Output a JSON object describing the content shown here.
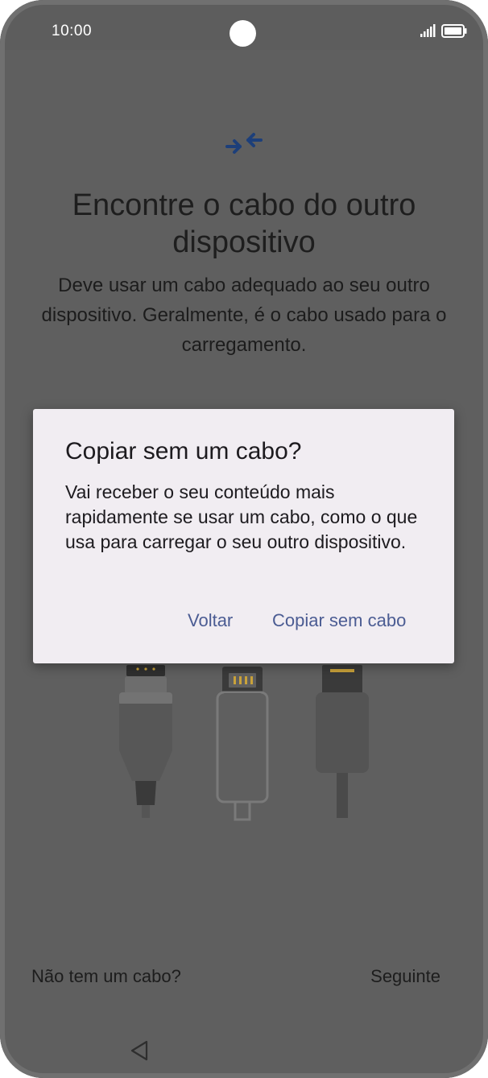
{
  "status_bar": {
    "time": "10:00"
  },
  "page": {
    "title": "Encontre o cabo do outro dispositivo",
    "description": "Deve usar um cabo adequado ao seu outro dispositivo. Geralmente, é o cabo usado para o carregamento.",
    "no_cable_label": "Não tem um cabo?",
    "next_label": "Seguinte"
  },
  "dialog": {
    "title": "Copiar sem um cabo?",
    "body": "Vai receber o seu conteúdo mais rapidamente se usar um cabo, como o que usa para carregar o seu outro dispositivo.",
    "back_label": "Voltar",
    "copy_label": "Copiar sem cabo"
  },
  "icons": {
    "hero": "transfer-arrows-icon",
    "signal": "signal-icon",
    "battery": "battery-icon",
    "nav_back": "nav-back-icon"
  },
  "colors": {
    "accent": "#4b5c93",
    "hero_icon": "#1d3f7a",
    "dialog_bg": "#f1edf2",
    "scrim": "#5f5f5f"
  }
}
